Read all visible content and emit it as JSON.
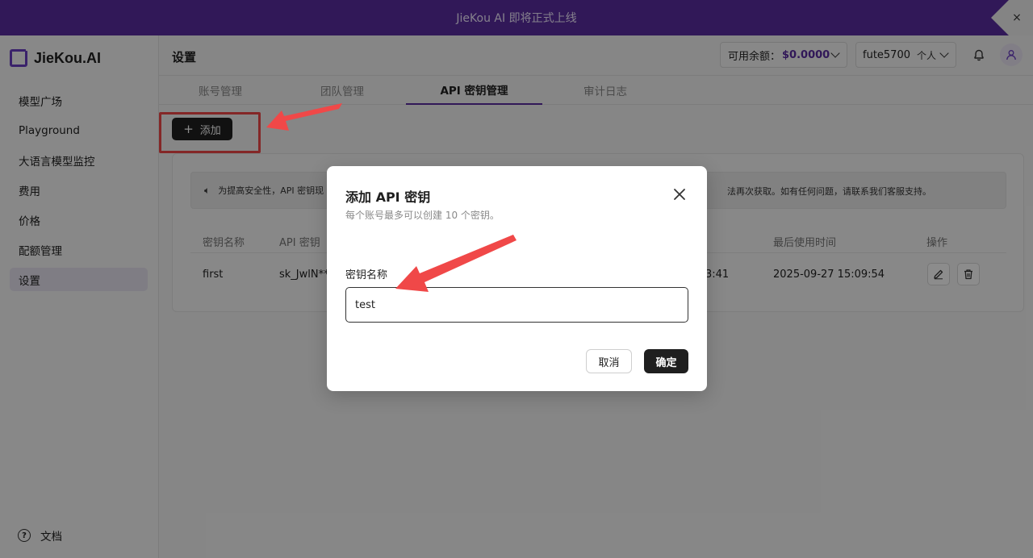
{
  "banner": {
    "text": "JieKou AI 即将正式上线",
    "close": "×"
  },
  "sidebar": {
    "logo": "JieKou.AI",
    "items": [
      {
        "label": "模型广场"
      },
      {
        "label": "Playground"
      },
      {
        "label": "大语言模型监控"
      },
      {
        "label": "费用"
      },
      {
        "label": "价格"
      },
      {
        "label": "配额管理"
      },
      {
        "label": "设置"
      }
    ],
    "docs": "文档"
  },
  "header": {
    "title": "设置",
    "balance_label": "可用余额：",
    "balance_value": "$0.0000",
    "username": "fute5700",
    "account_type": "个人"
  },
  "tabs": [
    {
      "label": "账号管理"
    },
    {
      "label": "团队管理"
    },
    {
      "label": "API 密钥管理"
    },
    {
      "label": "审计日志"
    }
  ],
  "toolbar": {
    "add_label": "添加"
  },
  "notice": {
    "head": "为提高安全性，API 密钥现",
    "tail": "法再次获取。如有任何问题，请联系我们客服支持。"
  },
  "table": {
    "headers": {
      "name": "密钥名称",
      "key": "API 密钥",
      "last_used": "最后使用时间",
      "actions": "操作"
    },
    "rows": [
      {
        "name": "first",
        "key": "sk_JwlN**",
        "created_tail": "3:41",
        "last_used": "2025-09-27 15:09:54"
      }
    ]
  },
  "modal": {
    "title": "添加 API 密钥",
    "subtitle": "每个账号最多可以创建 10 个密钥。",
    "field_label": "密钥名称",
    "field_value": "test",
    "cancel": "取消",
    "confirm": "确定"
  },
  "colors": {
    "banner": "#5a2ca0",
    "accent": "#5a2ca0",
    "annotation": "#f04848"
  }
}
